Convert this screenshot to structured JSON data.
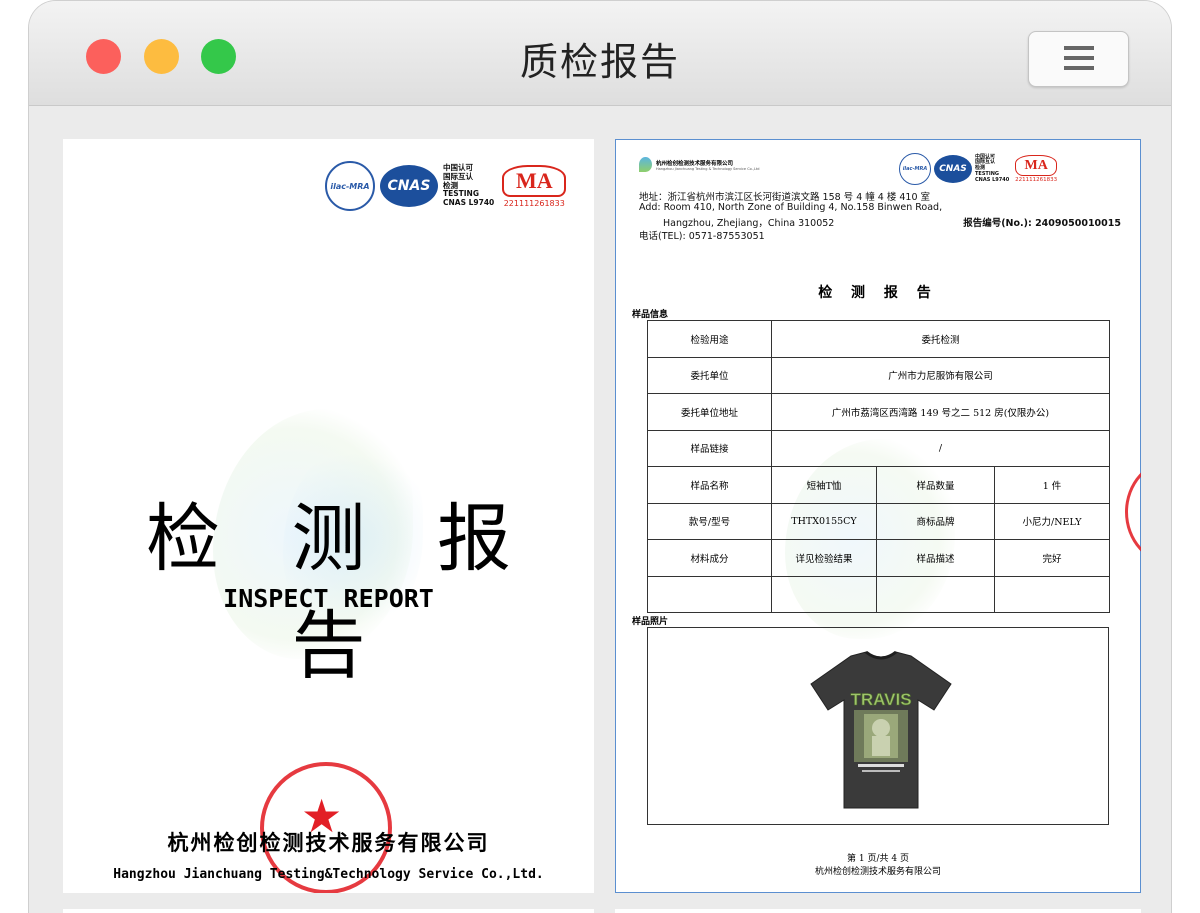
{
  "window": {
    "title": "质检报告"
  },
  "page1": {
    "logos": {
      "ilac": "ilac-MRA",
      "cnas": "CNAS",
      "cn_lines": [
        "中国认可",
        "国际互认",
        "检测",
        "TESTING",
        "CNAS L9740"
      ],
      "ma": "MA",
      "ma_number": "221111261833"
    },
    "title": "检  测  报  告",
    "subtitle": "INSPECT REPORT",
    "company_cn": "杭州检创检测技术服务有限公司",
    "company_en": "Hangzhou Jianchuang Testing&Technology Service Co.,Ltd.",
    "seal_text": "杭州检创检测技术服务有限公司"
  },
  "page2": {
    "header_company": "杭州检创检测技术服务有限公司",
    "header_company_en": "Hangzhou Jianchuang Testing & Technology Service Co.,Ltd",
    "logos": {
      "ilac": "ilac-MRA",
      "cnas": "CNAS",
      "cn_lines": [
        "中国认可",
        "国际互认",
        "检测",
        "TESTING",
        "CNAS L9740"
      ],
      "ma": "MA",
      "ma_number": "221111261833"
    },
    "address_cn": "地址：浙江省杭州市滨江区长河街道滨文路 158 号 4 幢 4 楼 410 室",
    "address_en1": "Add: Room 410, North Zone of Building 4, No.158 Binwen Road,",
    "address_en2": "Hangzhou, Zhejiang，China          310052",
    "tel": "电话(TEL):    0571-87553051",
    "report_no": "报告编号(No.): 2409050010015",
    "report_title": "检 测 报 告",
    "section_info": "样品信息",
    "section_photo": "样品照片",
    "rows": {
      "purpose_label": "检验用途",
      "purpose_value": "委托检测",
      "client_label": "委托单位",
      "client_value": "广州市力尼服饰有限公司",
      "client_addr_label": "委托单位地址",
      "client_addr_value": "广州市荔湾区西湾路 149 号之二 512 房(仅限办公)",
      "link_label": "样品链接",
      "link_value": "/",
      "name_label": "样品名称",
      "name_value": "短袖T恤",
      "qty_label": "样品数量",
      "qty_value": "1 件",
      "model_label": "款号/型号",
      "model_value": "THTX0155CY",
      "brand_label": "商标品牌",
      "brand_value": "小尼力/NELY",
      "material_label": "材料成分",
      "material_value": "详见检验结果",
      "desc_label": "样品描述",
      "desc_value": "完好"
    },
    "shirt_print": "TRAVIS",
    "page_num": "第 1 页/共 4 页",
    "footer_company": "杭州检创检测技术服务有限公司"
  },
  "colors": {
    "seal_red": "#e21f26",
    "frame_blue": "#5b8fd0",
    "cnas_blue": "#1c4f9c",
    "ma_red": "#d9261c"
  }
}
